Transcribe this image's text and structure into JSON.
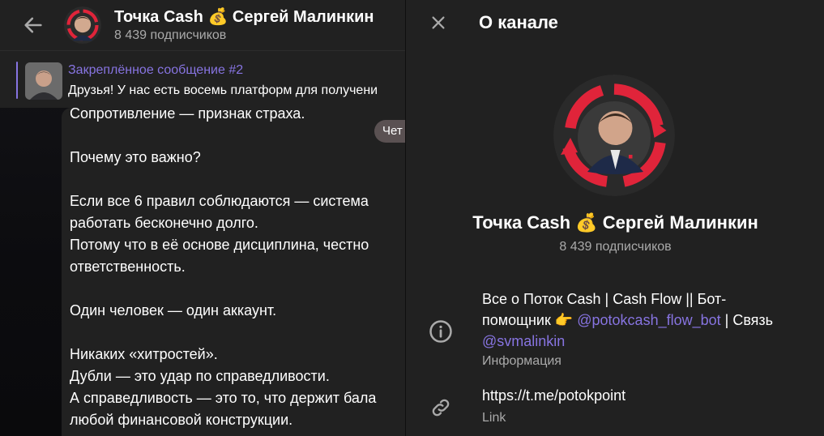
{
  "chat": {
    "header": {
      "title": "Точка Cash 💰 Сергей Малинкин",
      "subscribers": "8 439 подписчиков"
    },
    "pinned": {
      "title": "Закреплённое сообщение #2",
      "text": "Друзья! У нас есть восемь платформ для получени"
    },
    "message_lines": [
      "Сопротивление — признак страха.",
      "",
      "Почему это важно?",
      "",
      "Если все 6 правил соблюдаются — система",
      "работать бесконечно долго.",
      "Потому что в её основе дисциплина, честно",
      "ответственность.",
      "",
      "Один человек — один аккаунт.",
      "",
      "Никаких «хитростей».",
      "Дубли — это удар по справедливости.",
      "А справедливость — это то, что держит бала",
      "любой финансовой конструкции."
    ],
    "chip": "Чет"
  },
  "info": {
    "title": "О канале",
    "channel_name": "Точка Cash 💰 Сергей Малинкин",
    "subscribers": "8 439 подписчиков",
    "description_part1": "Все о Поток Cash | Cash Flow || Бот-помощник 👉 ",
    "bot_mention": "@potokcash_flow_bot",
    "description_part2": " | Связь ",
    "contact_mention": "@svmalinkin",
    "description_caption": "Информация",
    "link": "https://t.me/potokpoint",
    "link_caption": "Link"
  },
  "colors": {
    "accent": "#8774e1",
    "panel": "#212121",
    "secondary_text": "#aaaaaa",
    "logo_red": "#e0243a"
  },
  "icons": {
    "back": "arrow-left-icon",
    "close": "close-icon",
    "info": "info-icon",
    "link": "link-icon"
  }
}
